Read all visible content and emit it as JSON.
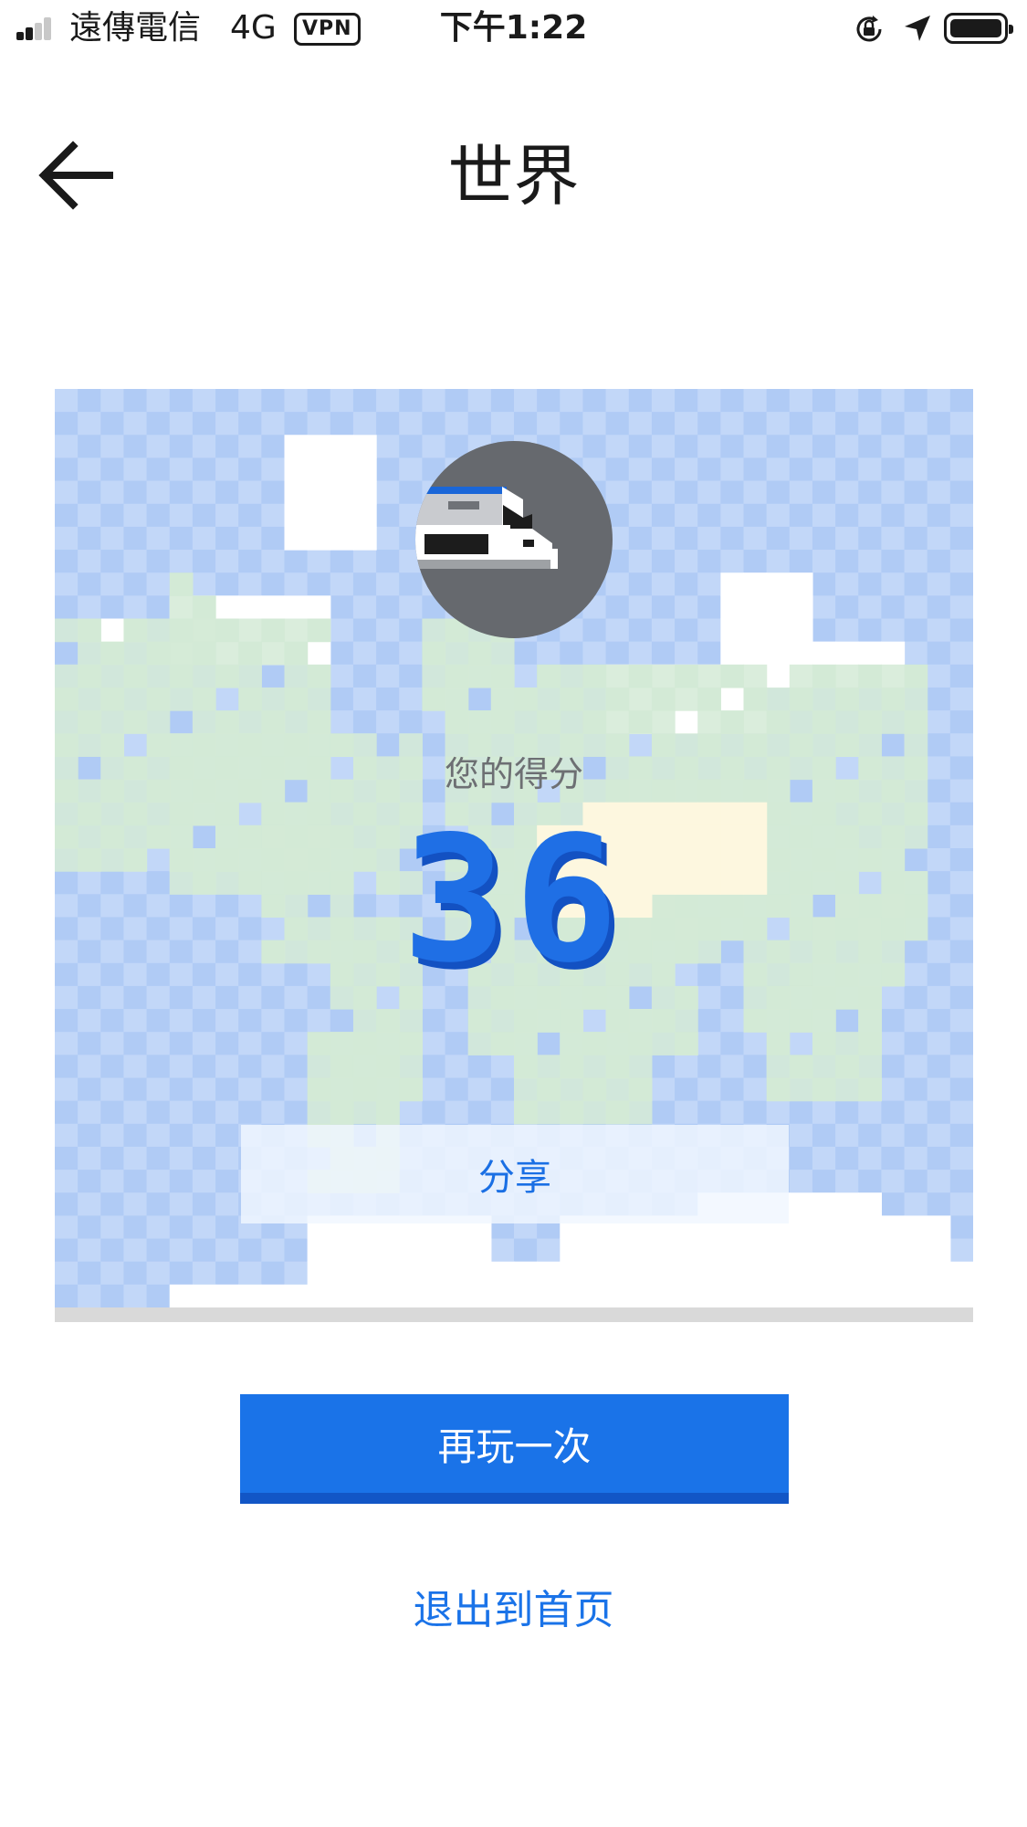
{
  "status_bar": {
    "carrier": "遠傳電信",
    "network": "4G",
    "vpn": "VPN",
    "time": "下午1:22",
    "icons": [
      "signal-icon",
      "orientation-lock-icon",
      "location-arrow-icon",
      "battery-icon"
    ]
  },
  "header": {
    "back_icon": "arrow-left-icon",
    "title": "世界"
  },
  "result": {
    "avatar_icon": "train-icon",
    "score_label": "您的得分",
    "score": "36",
    "share_label": "分享"
  },
  "actions": {
    "play_again": "再玩一次",
    "exit_home": "退出到首页"
  },
  "colors": {
    "accent": "#1a73e8",
    "score_blue": "#1f6fe5",
    "map_water_light": "#c2d7f8",
    "map_water_dark": "#b0cbf5",
    "map_land": "#d3ead6",
    "map_ice": "#ffffff",
    "map_desert": "#fdf7df"
  }
}
